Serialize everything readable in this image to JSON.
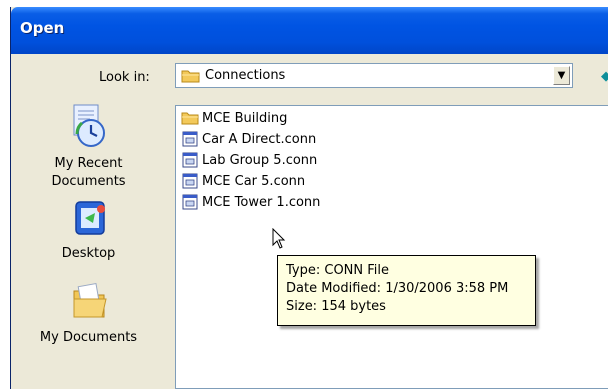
{
  "window": {
    "title": "Open"
  },
  "lookin": {
    "label": "Look in:",
    "value": "Connections"
  },
  "places": [
    {
      "label_line1": "My Recent",
      "label_line2": "Documents",
      "icon": "recent-documents-icon"
    },
    {
      "label_line1": "Desktop",
      "label_line2": "",
      "icon": "desktop-icon"
    },
    {
      "label_line1": "My Documents",
      "label_line2": "",
      "icon": "my-documents-icon"
    }
  ],
  "files": [
    {
      "name": "MCE Building",
      "icon": "folder-icon"
    },
    {
      "name": "Car A Direct.conn",
      "icon": "conn-file-icon"
    },
    {
      "name": "Lab Group 5.conn",
      "icon": "conn-file-icon"
    },
    {
      "name": "MCE Car 5.conn",
      "icon": "conn-file-icon"
    },
    {
      "name": "MCE Tower 1.conn",
      "icon": "conn-file-icon"
    }
  ],
  "tooltip": {
    "type": "Type: CONN File",
    "modified": "Date Modified: 1/30/2006 3:58 PM",
    "size": "Size: 154 bytes"
  },
  "colors": {
    "titlebar": "#0054E3",
    "dialog_bg": "#ECE9D8",
    "tooltip_bg": "#FFFFE1",
    "field_border": "#7F9DB9"
  }
}
